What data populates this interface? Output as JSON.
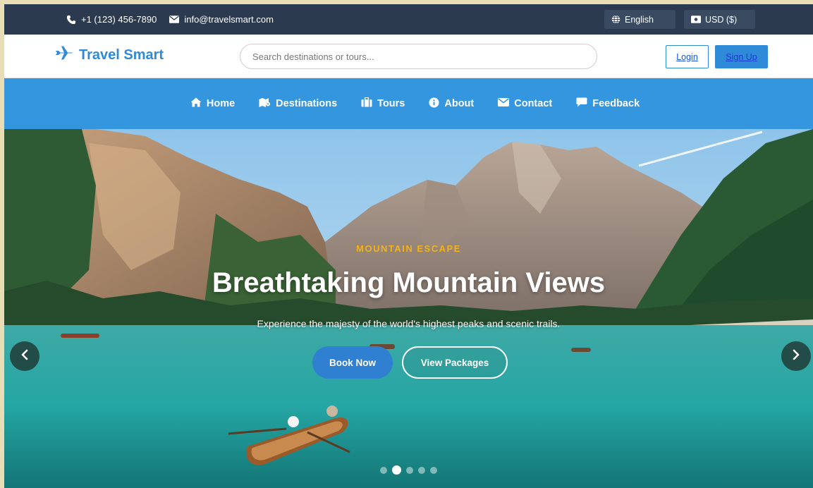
{
  "topbar": {
    "phone": "+1 (123) 456-7890",
    "email": "info@travelsmart.com",
    "language": "English",
    "currency": "USD ($)"
  },
  "header": {
    "logo_text": "Travel Smart",
    "search_placeholder": "Search destinations or tours...",
    "login_label": "Login",
    "signup_label": "Sign Up"
  },
  "nav": {
    "items": [
      {
        "label": "Home",
        "icon": "home-icon"
      },
      {
        "label": "Destinations",
        "icon": "map-icon"
      },
      {
        "label": "Tours",
        "icon": "suitcase-icon"
      },
      {
        "label": "About",
        "icon": "info-icon"
      },
      {
        "label": "Contact",
        "icon": "envelope-icon"
      },
      {
        "label": "Feedback",
        "icon": "comment-icon"
      }
    ]
  },
  "hero": {
    "eyebrow": "MOUNTAIN ESCAPE",
    "title": "Breathtaking Mountain Views",
    "subtitle": "Experience the majesty of the world's highest peaks and scenic trails.",
    "book_label": "Book Now",
    "view_label": "View Packages",
    "slide_count": 5,
    "active_slide": 2
  },
  "colors": {
    "topbar_bg": "#2c3a4f",
    "brand_blue": "#2f8ad8",
    "nav_bg": "#3596e0",
    "accent_yellow": "#f2b21e"
  }
}
